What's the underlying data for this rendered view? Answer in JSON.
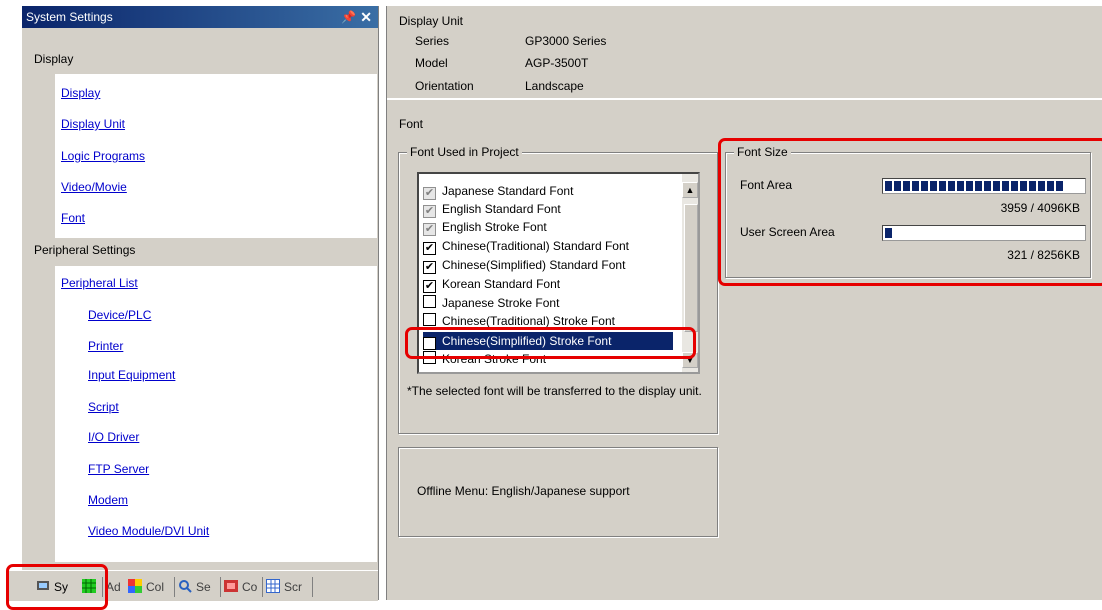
{
  "left_panel": {
    "title": "System Settings",
    "pin_icon": "pin-icon",
    "close_icon": "close-icon",
    "display_section": {
      "header": "Display",
      "items": [
        "Display",
        "Display Unit",
        "Logic Programs",
        "Video/Movie",
        "Font"
      ]
    },
    "peripheral_section": {
      "header": "Peripheral Settings",
      "items": [
        "Peripheral List",
        "Device/PLC",
        "Printer",
        "Input Equipment",
        "Script",
        "I/O Driver",
        "FTP Server",
        "Modem",
        "Video Module/DVI Unit"
      ]
    },
    "tabs": [
      {
        "label": "Sy",
        "icon": "system-settings-icon"
      },
      {
        "label": "",
        "icon": "grid-icon"
      },
      {
        "label": "Ad",
        "icon": "address-icon"
      },
      {
        "label": "Col",
        "icon": "color-icon"
      },
      {
        "label": "Se",
        "icon": "search-icon"
      },
      {
        "label": "Co",
        "icon": "common-icon"
      },
      {
        "label": "Scr",
        "icon": "screen-icon"
      }
    ]
  },
  "display_unit": {
    "heading": "Display Unit",
    "rows": [
      {
        "label": "Series",
        "value": "GP3000 Series"
      },
      {
        "label": "Model",
        "value": "AGP-3500T"
      },
      {
        "label": "Orientation",
        "value": "Landscape"
      }
    ]
  },
  "font": {
    "heading": "Font",
    "font_used": {
      "title": "Font Used in Project",
      "items": [
        {
          "label": "Japanese Standard Font",
          "checked": true,
          "disabled": true
        },
        {
          "label": "English Standard Font",
          "checked": true,
          "disabled": true
        },
        {
          "label": "English Stroke Font",
          "checked": true,
          "disabled": true
        },
        {
          "label": "Chinese(Traditional) Standard Font",
          "checked": true,
          "disabled": false
        },
        {
          "label": "Chinese(Simplified) Standard Font",
          "checked": true,
          "disabled": false
        },
        {
          "label": "Korean Standard Font",
          "checked": true,
          "disabled": false
        },
        {
          "label": "Japanese Stroke Font",
          "checked": false,
          "disabled": false
        },
        {
          "label": "Chinese(Traditional) Stroke Font",
          "checked": false,
          "disabled": false
        },
        {
          "label": "Chinese(Simplified) Stroke Font",
          "checked": true,
          "disabled": false,
          "selected": true
        },
        {
          "label": "Korean Stroke Font",
          "checked": false,
          "disabled": false
        }
      ],
      "note": "*The selected font will be transferred to the display unit."
    },
    "offline_menu": "Offline Menu: English/Japanese support",
    "font_size": {
      "title": "Font Size",
      "font_area_label": "Font Area",
      "font_area_value": "3959 / 4096KB",
      "font_area_fraction": 0.97,
      "user_screen_label": "User Screen Area",
      "user_screen_value": "321 / 8256KB",
      "user_screen_fraction": 0.04
    }
  },
  "colors": {
    "highlight": "#e60000",
    "link": "#0000cc",
    "selection": "#0a246a"
  }
}
